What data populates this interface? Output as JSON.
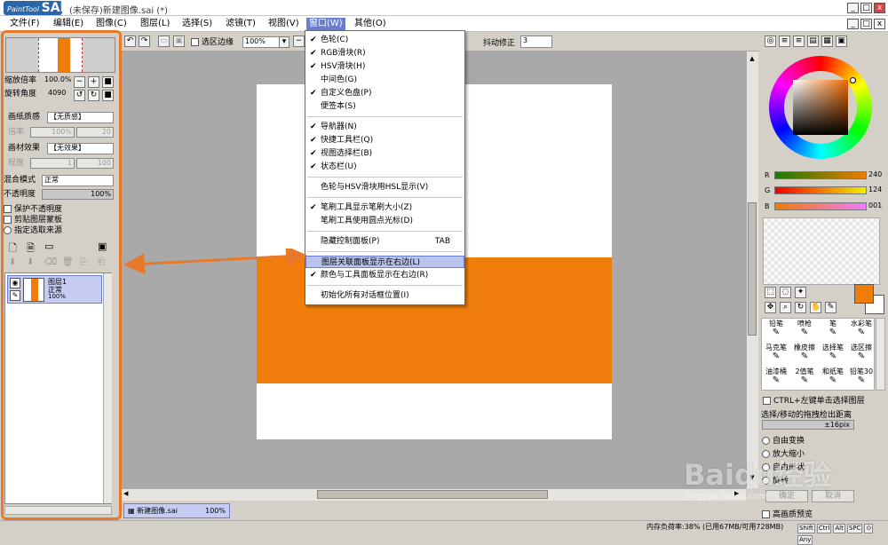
{
  "app": {
    "logo_small": "PaintTool",
    "logo_big": "SAI",
    "title": "(未保存)新建图像.sai (*)"
  },
  "window_buttons": [
    "_",
    "□",
    "x"
  ],
  "menu": {
    "items": [
      "文件(F)",
      "编辑(E)",
      "图像(C)",
      "图层(L)",
      "选择(S)",
      "滤镜(T)",
      "视图(V)",
      "窗口(W)",
      "其他(O)"
    ]
  },
  "window_menu": [
    {
      "label": "色轮(C)",
      "checked": true
    },
    {
      "label": "RGB滑块(R)",
      "checked": true
    },
    {
      "label": "HSV滑块(H)",
      "checked": true
    },
    {
      "label": "中间色(G)",
      "checked": false
    },
    {
      "label": "自定义色盘(P)",
      "checked": true
    },
    {
      "label": "便签本(S)",
      "checked": false
    },
    {
      "label": "导航器(N)",
      "checked": true
    },
    {
      "label": "快捷工具栏(Q)",
      "checked": true
    },
    {
      "label": "视图选择栏(B)",
      "checked": true
    },
    {
      "label": "状态栏(U)",
      "checked": true
    },
    {
      "label": "色轮与HSV滑块用HSL显示(V)",
      "checked": false
    },
    {
      "label": "笔刷工具显示笔刷大小(Z)",
      "checked": true
    },
    {
      "label": "笔刷工具使用圆点光标(D)",
      "checked": false
    },
    {
      "label": "隐藏控制面板(P)",
      "checked": false,
      "shortcut": "TAB"
    },
    {
      "label": "图层关联面板显示在右边(L)",
      "checked": false,
      "highlight": true
    },
    {
      "label": "颜色与工具面板显示在右边(R)",
      "checked": true
    },
    {
      "label": "初始化所有对话框位置(I)",
      "checked": false
    }
  ],
  "toolbar": {
    "selection_edge": "选区边缘",
    "zoom": "100%",
    "stabilizer_label": "抖动修正",
    "stabilizer_value": "3"
  },
  "left_panel": {
    "zoom_label": "缩放倍率",
    "zoom_value": "100.0%",
    "rotate_label": "旋转角度",
    "rotate_value": "4090",
    "paper_texture_label": "画纸质感",
    "paper_texture_value": "【无质感】",
    "rate_label": "倍率",
    "rate_value": "100%",
    "strength_label": "强度",
    "strength_value": "20",
    "paper_effect_label": "画材效果",
    "paper_effect_value": "【无效果】",
    "degree_label": "程度",
    "degree_value": "1",
    "strength2_label": "强度",
    "strength2_value": "100",
    "blend_label": "混合模式",
    "blend_value": "正常",
    "opacity_label": "不透明度",
    "opacity_value": "100%",
    "opts": [
      "保护不透明度",
      "剪贴图层蒙板",
      "指定选取来源"
    ],
    "layer": {
      "name": "图层1",
      "mode": "正常",
      "opacity": "100%"
    }
  },
  "document_tab": {
    "name": "新建图像.sai",
    "zoom": "100%"
  },
  "right_panel": {
    "r_label": "R",
    "r_value": "240",
    "g_label": "G",
    "g_value": "124",
    "b_label": "B",
    "b_value": "001",
    "tools": [
      "铅笔",
      "喷枪",
      "笔",
      "水彩笔",
      "马克笔",
      "橡皮擦",
      "选择笔",
      "选区擦",
      "油漆桶",
      "2值笔",
      "和纸笔",
      "铅笔30"
    ],
    "ctrl_option": "CTRL+左键单击选择图层",
    "drag_label": "选择/移动的拖拽检出距离",
    "drag_value": "±16pix",
    "radios": [
      "自由变换",
      "放大缩小",
      "自由形状",
      "旋转"
    ],
    "hq_preview": "高画质预览",
    "ok_button": "确定",
    "cancel_button": "取消"
  },
  "status": {
    "memory": "内存负荷率:38% (已用67MB/可用728MB)",
    "keys": [
      "Shift",
      "Ctrl",
      "Alt",
      "SPC",
      "⊙",
      "Any"
    ]
  },
  "watermark": {
    "brand": "Baidu经验",
    "url": "jingyan.baidu.com"
  },
  "colors": {
    "accent_orange": "#f07d0a",
    "highlight_blue": "#6a7fd0",
    "callout_orange": "#e8792a"
  }
}
